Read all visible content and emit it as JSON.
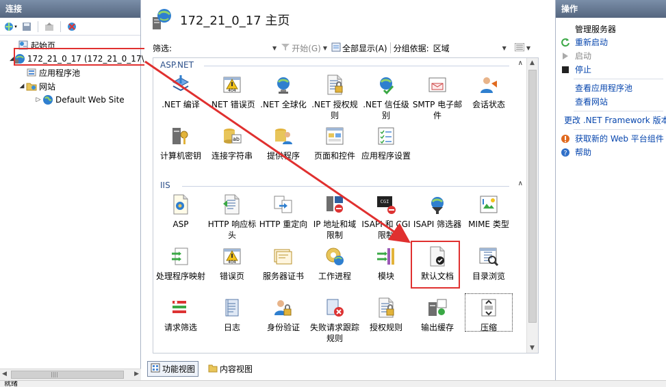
{
  "connections": {
    "title": "连接",
    "tree": [
      {
        "label": "起始页",
        "level": 0,
        "icon": "start-page-icon"
      },
      {
        "label": "172_21_0_17 (172_21_0_17\\",
        "level": 0,
        "icon": "server-icon",
        "expanded": true
      },
      {
        "label": "应用程序池",
        "level": 1,
        "icon": "app-pool-icon"
      },
      {
        "label": "网站",
        "level": 1,
        "icon": "sites-folder-icon",
        "expanded": true
      },
      {
        "label": "Default Web Site",
        "level": 2,
        "icon": "globe-icon",
        "collapsed": true
      }
    ]
  },
  "center": {
    "title": "172_21_0_17 主页",
    "filter_label": "筛选:",
    "filter_value": "",
    "start_label": "开始(G)",
    "show_all_label": "全部显示(A)",
    "group_by_label": "分组依据:",
    "group_by_value": "区域",
    "groups": [
      {
        "name": "ASP.NET",
        "items": [
          {
            "label": ".NET 编译",
            "icon": "net-compile-icon"
          },
          {
            "label": ".NET 错误页",
            "icon": "net-error-page-icon"
          },
          {
            "label": ".NET 全球化",
            "icon": "net-globalization-icon"
          },
          {
            "label": ".NET 授权规则",
            "icon": "net-authorization-icon"
          },
          {
            "label": ".NET 信任级别",
            "icon": "net-trust-level-icon"
          },
          {
            "label": "SMTP 电子邮件",
            "icon": "smtp-email-icon"
          },
          {
            "label": "会话状态",
            "icon": "session-state-icon"
          },
          {
            "label": "计算机密钥",
            "icon": "machine-key-icon"
          },
          {
            "label": "连接字符串",
            "icon": "connection-strings-icon"
          },
          {
            "label": "提供程序",
            "icon": "providers-icon"
          },
          {
            "label": "页面和控件",
            "icon": "pages-controls-icon"
          },
          {
            "label": "应用程序设置",
            "icon": "app-settings-icon"
          }
        ]
      },
      {
        "name": "IIS",
        "items": [
          {
            "label": "ASP",
            "icon": "asp-icon"
          },
          {
            "label": "HTTP 响应标头",
            "icon": "http-response-headers-icon"
          },
          {
            "label": "HTTP 重定向",
            "icon": "http-redirect-icon"
          },
          {
            "label": "IP 地址和域限制",
            "icon": "ip-domain-restrictions-icon"
          },
          {
            "label": "ISAPI 和 CGI 限制",
            "icon": "isapi-cgi-restrictions-icon"
          },
          {
            "label": "ISAPI 筛选器",
            "icon": "isapi-filters-icon"
          },
          {
            "label": "MIME 类型",
            "icon": "mime-types-icon"
          },
          {
            "label": "处理程序映射",
            "icon": "handler-mappings-icon"
          },
          {
            "label": "错误页",
            "icon": "error-pages-icon"
          },
          {
            "label": "服务器证书",
            "icon": "server-certificates-icon"
          },
          {
            "label": "工作进程",
            "icon": "worker-processes-icon"
          },
          {
            "label": "模块",
            "icon": "modules-icon"
          },
          {
            "label": "默认文档",
            "icon": "default-document-icon"
          },
          {
            "label": "目录浏览",
            "icon": "directory-browsing-icon"
          },
          {
            "label": "请求筛选",
            "icon": "request-filtering-icon"
          },
          {
            "label": "日志",
            "icon": "logging-icon"
          },
          {
            "label": "身份验证",
            "icon": "authentication-icon"
          },
          {
            "label": "失败请求跟踪规则",
            "icon": "failed-request-tracing-icon"
          },
          {
            "label": "授权规则",
            "icon": "authorization-rules-icon"
          },
          {
            "label": "输出缓存",
            "icon": "output-caching-icon"
          },
          {
            "label": "压缩",
            "icon": "compression-icon"
          }
        ]
      }
    ],
    "view_tabs": [
      {
        "label": "功能视图",
        "active": true
      },
      {
        "label": "内容视图",
        "active": false
      }
    ]
  },
  "actions": {
    "title": "操作",
    "sections": [
      {
        "heading": "管理服务器",
        "items": [
          {
            "label": "重新启动",
            "icon": "restart-icon",
            "enabled": true
          },
          {
            "label": "启动",
            "icon": "start-icon",
            "enabled": false
          },
          {
            "label": "停止",
            "icon": "stop-icon",
            "enabled": true
          }
        ]
      },
      {
        "heading": "",
        "items": [
          {
            "label": "查看应用程序池",
            "icon": "",
            "enabled": true
          },
          {
            "label": "查看网站",
            "icon": "",
            "enabled": true
          }
        ]
      },
      {
        "heading": "",
        "items": [
          {
            "label": "更改 .NET Framework 版本",
            "icon": "",
            "enabled": true
          }
        ]
      },
      {
        "heading": "",
        "items": [
          {
            "label": "获取新的 Web 平台组件",
            "icon": "web-platform-icon",
            "enabled": true
          },
          {
            "label": "帮助",
            "icon": "help-icon",
            "enabled": true
          }
        ]
      }
    ]
  },
  "status": {
    "text": "就绪"
  },
  "colors": {
    "highlight": "#e0302f",
    "link": "#0645ad",
    "panel_header": "#55667f"
  }
}
